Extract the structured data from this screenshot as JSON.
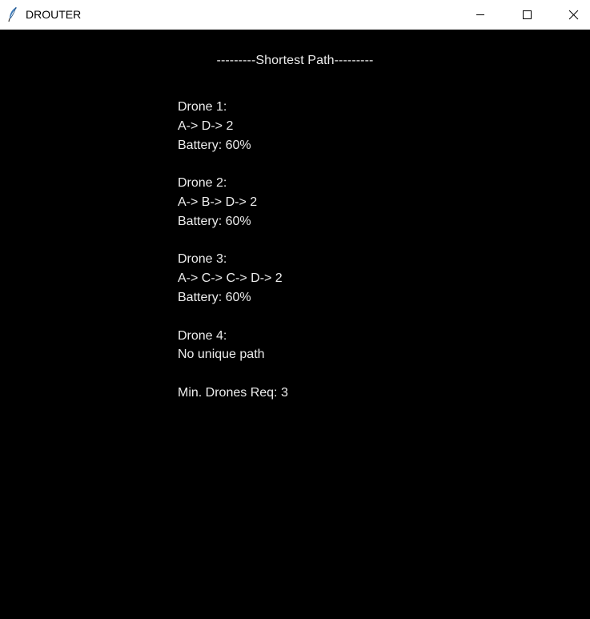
{
  "window": {
    "title": "DROUTER",
    "icon": "feather-icon",
    "controls": [
      "minimize-icon",
      "maximize-icon",
      "close-icon"
    ]
  },
  "content": {
    "heading": "---------Shortest Path---------",
    "drones": [
      {
        "name": "Drone 1:",
        "path": "A-> D-> 2",
        "battery": "Battery: 60%"
      },
      {
        "name": "Drone 2:",
        "path": "A-> B-> D-> 2",
        "battery": "Battery: 60%"
      },
      {
        "name": "Drone 3:",
        "path": "A-> C-> C-> D-> 2",
        "battery": "Battery: 60%"
      },
      {
        "name": "Drone 4:",
        "path": "No unique path"
      }
    ],
    "summary": "Min. Drones Req: 3"
  },
  "colors": {
    "background": "#000000",
    "text": "#ececec",
    "titlebar": "#ffffff"
  }
}
